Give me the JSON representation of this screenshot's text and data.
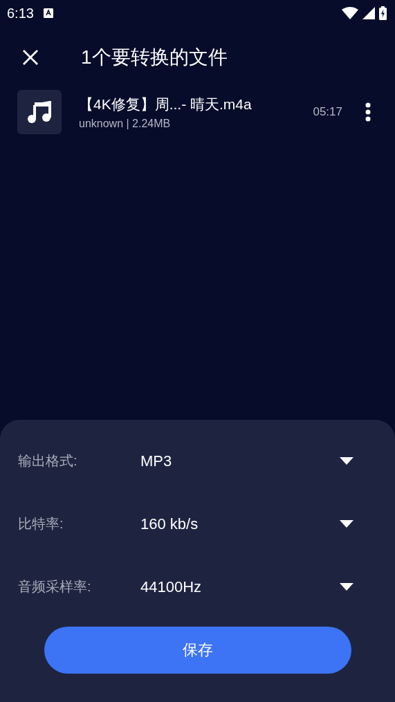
{
  "status_bar": {
    "time": "6:13"
  },
  "toolbar": {
    "title": "1个要转换的文件"
  },
  "files": [
    {
      "name": "【4K修复】周...- 晴天.m4a",
      "meta": "unknown | 2.24MB",
      "duration": "05:17"
    }
  ],
  "settings": [
    {
      "label": "输出格式:",
      "value": "MP3"
    },
    {
      "label": "比特率:",
      "value": "160 kb/s"
    },
    {
      "label": "音频采样率:",
      "value": "44100Hz"
    }
  ],
  "save_button": "保存"
}
